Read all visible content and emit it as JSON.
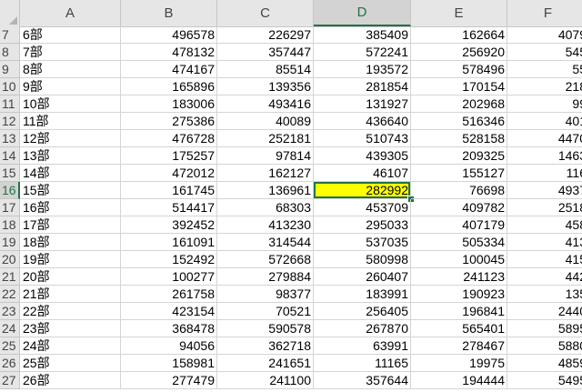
{
  "columns": [
    "A",
    "B",
    "C",
    "D",
    "E",
    "F"
  ],
  "selected_column": "D",
  "selected_row": "16",
  "highlight_color": "#ffff00",
  "accent_color": "#217346",
  "rows": [
    {
      "num": "7",
      "a": "6部",
      "b": "496578",
      "c": "226297",
      "d": "385409",
      "e": "162664",
      "f": "4079"
    },
    {
      "num": "8",
      "a": "7部",
      "b": "478132",
      "c": "357447",
      "d": "572241",
      "e": "256920",
      "f": "545"
    },
    {
      "num": "9",
      "a": "8部",
      "b": "474167",
      "c": "85514",
      "d": "193572",
      "e": "578496",
      "f": "55"
    },
    {
      "num": "10",
      "a": "9部",
      "b": "165896",
      "c": "139356",
      "d": "281854",
      "e": "170154",
      "f": "218"
    },
    {
      "num": "11",
      "a": "10部",
      "b": "183006",
      "c": "493416",
      "d": "131927",
      "e": "202968",
      "f": "99"
    },
    {
      "num": "12",
      "a": "11部",
      "b": "275386",
      "c": "40089",
      "d": "436640",
      "e": "516346",
      "f": "401"
    },
    {
      "num": "13",
      "a": "12部",
      "b": "476728",
      "c": "252181",
      "d": "510743",
      "e": "528158",
      "f": "4470"
    },
    {
      "num": "14",
      "a": "13部",
      "b": "175257",
      "c": "97814",
      "d": "439305",
      "e": "209325",
      "f": "1463"
    },
    {
      "num": "15",
      "a": "14部",
      "b": "472012",
      "c": "162127",
      "d": "46107",
      "e": "155127",
      "f": "116"
    },
    {
      "num": "16",
      "a": "15部",
      "b": "161745",
      "c": "136961",
      "d": "282992",
      "e": "76698",
      "f": "4937"
    },
    {
      "num": "17",
      "a": "16部",
      "b": "514417",
      "c": "68303",
      "d": "453709",
      "e": "409782",
      "f": "2518"
    },
    {
      "num": "18",
      "a": "17部",
      "b": "392452",
      "c": "413230",
      "d": "295033",
      "e": "407179",
      "f": "458"
    },
    {
      "num": "19",
      "a": "18部",
      "b": "161091",
      "c": "314544",
      "d": "537035",
      "e": "505334",
      "f": "413"
    },
    {
      "num": "20",
      "a": "19部",
      "b": "152492",
      "c": "572668",
      "d": "580998",
      "e": "100045",
      "f": "415"
    },
    {
      "num": "21",
      "a": "20部",
      "b": "100277",
      "c": "279884",
      "d": "260407",
      "e": "241123",
      "f": "442"
    },
    {
      "num": "22",
      "a": "21部",
      "b": "261758",
      "c": "98377",
      "d": "183991",
      "e": "190923",
      "f": "135"
    },
    {
      "num": "23",
      "a": "22部",
      "b": "423154",
      "c": "70521",
      "d": "256405",
      "e": "196841",
      "f": "2440"
    },
    {
      "num": "24",
      "a": "23部",
      "b": "368478",
      "c": "590578",
      "d": "267870",
      "e": "565401",
      "f": "5895"
    },
    {
      "num": "25",
      "a": "24部",
      "b": "94056",
      "c": "362718",
      "d": "63991",
      "e": "278467",
      "f": "5880"
    },
    {
      "num": "26",
      "a": "25部",
      "b": "158981",
      "c": "241651",
      "d": "11165",
      "e": "19975",
      "f": "4859"
    },
    {
      "num": "27",
      "a": "26部",
      "b": "277479",
      "c": "241100",
      "d": "357644",
      "e": "194444",
      "f": "5495"
    }
  ]
}
